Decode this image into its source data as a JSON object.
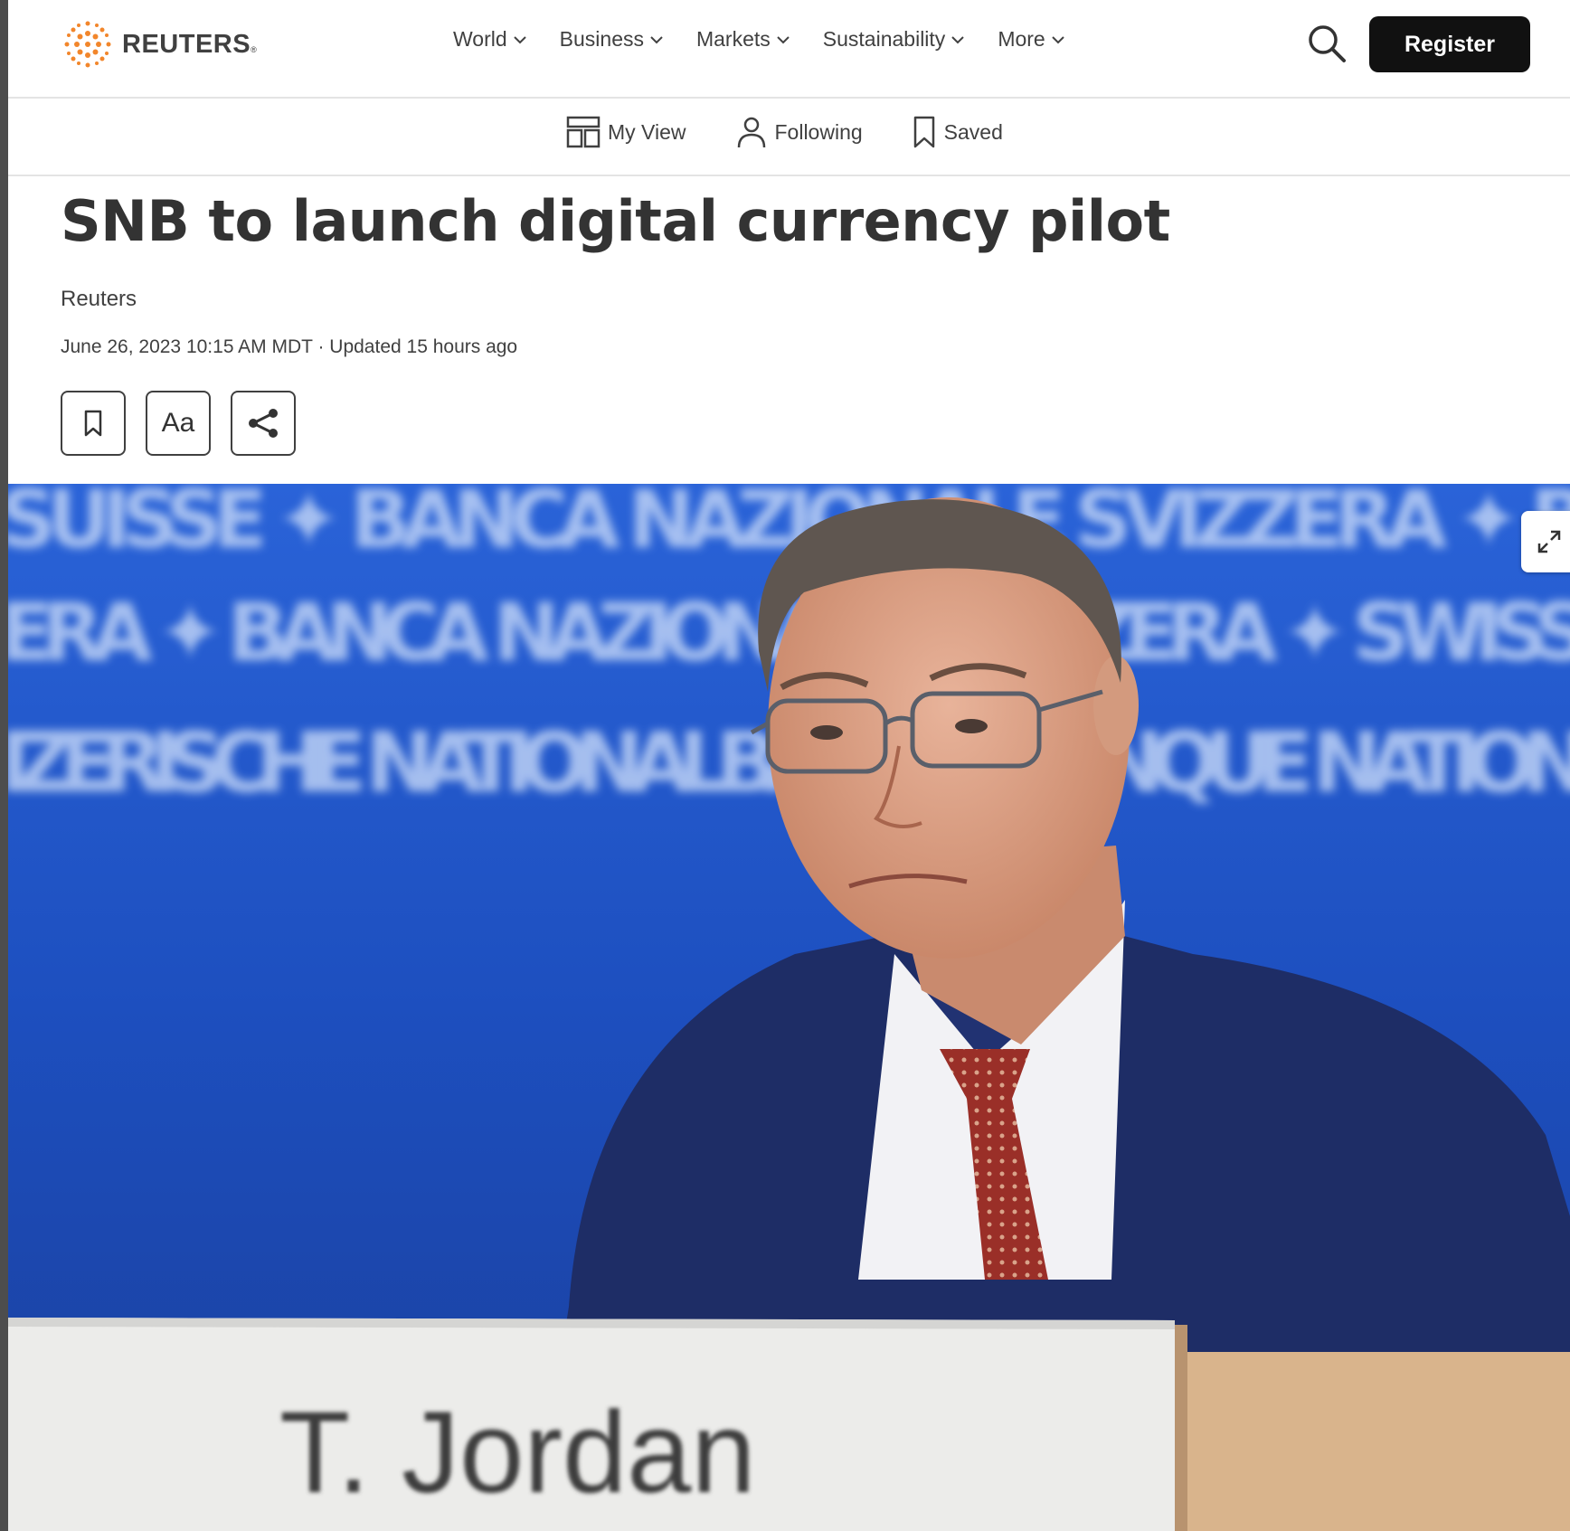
{
  "brand": {
    "name": "REUTERS",
    "reg_mark": "®"
  },
  "nav": {
    "items": [
      {
        "label": "World"
      },
      {
        "label": "Business"
      },
      {
        "label": "Markets"
      },
      {
        "label": "Sustainability"
      },
      {
        "label": "More"
      }
    ],
    "register_label": "Register"
  },
  "subnav": {
    "my_view": "My View",
    "following": "Following",
    "saved": "Saved"
  },
  "article": {
    "headline": "SNB to launch digital currency pilot",
    "byline": "Reuters",
    "dateline": "June 26, 2023 10:15 AM MDT · Updated 15 hours ago",
    "font_size_button": "Aa"
  },
  "photo": {
    "nameplate_text": "T. Jordan",
    "backdrop_text_row1": "SUISSE ✦ BANCA NAZIONALE SVIZZERA ✦ B",
    "backdrop_text_row2": "ERA ✦ BANCA NAZIONALE SVIZZERA ✦ SWISS",
    "backdrop_text_row3": "IZERISCHE NATIONALBANK ✦ BANQUE NATION",
    "colors": {
      "backdrop": "#1f57c9",
      "suit": "#1e2d66",
      "tie": "#9a2f28"
    }
  }
}
